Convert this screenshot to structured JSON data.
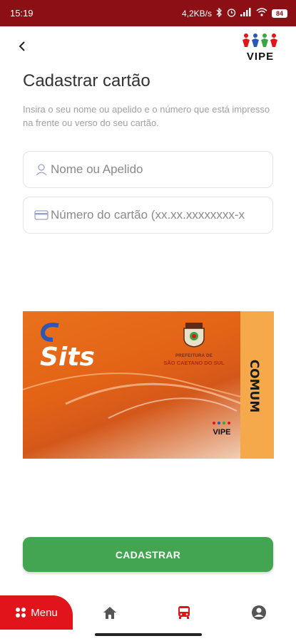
{
  "status_bar": {
    "time": "15:19",
    "network_speed": "4,2KB/s",
    "battery": "84"
  },
  "header": {
    "back_icon": "chevron-left-icon",
    "logo_text": "VIPE"
  },
  "page": {
    "title": "Cadastrar cartão",
    "subtitle": "Insira o seu nome ou apelido e o número que está impresso na frente ou verso do seu cartão."
  },
  "form": {
    "name_placeholder": "Nome ou Apelido",
    "name_value": "",
    "card_placeholder": "Número do cartão (xx.xx.xxxxxxxx-x",
    "card_value": ""
  },
  "card_image": {
    "brand": "Sits",
    "prefeitura": "PREFEITURA DE",
    "city": "SÃO CAETANO DO SUL",
    "type": "COMUM",
    "vipe": "VIPE"
  },
  "actions": {
    "submit_label": "CADASTRAR"
  },
  "bottom_nav": {
    "menu_label": "Menu",
    "items": [
      "home-icon",
      "bus-icon",
      "account-icon"
    ],
    "active_color": "#e2141b"
  },
  "colors": {
    "status_bar": "#8b0f14",
    "primary_button": "#43a451",
    "menu": "#e2141b"
  }
}
